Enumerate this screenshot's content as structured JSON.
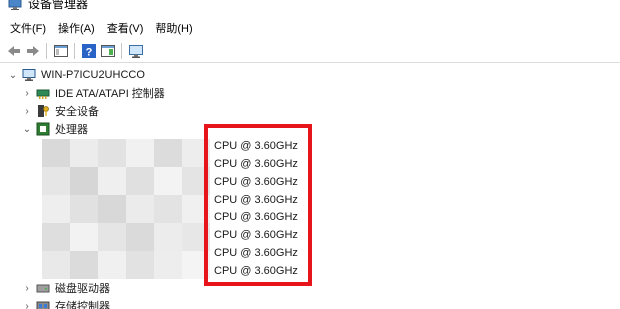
{
  "window": {
    "title": "设备管理器"
  },
  "menu": {
    "items": [
      "文件(F)",
      "操作(A)",
      "查看(V)",
      "帮助(H)"
    ]
  },
  "tree": {
    "root": "WIN-P7ICU2UHCCO",
    "categories": {
      "ide": "IDE ATA/ATAPI 控制器",
      "security": "安全设备",
      "processor": "处理器",
      "disk": "磁盘驱动器",
      "storage": "存储控制器"
    },
    "processors": [
      "CPU @ 3.60GHz",
      "CPU @ 3.60GHz",
      "CPU @ 3.60GHz",
      "CPU @ 3.60GHz",
      "CPU @ 3.60GHz",
      "CPU @ 3.60GHz",
      "CPU @ 3.60GHz",
      "CPU @ 3.60GHz"
    ]
  },
  "colors": {
    "highlight": "#e8141c"
  }
}
